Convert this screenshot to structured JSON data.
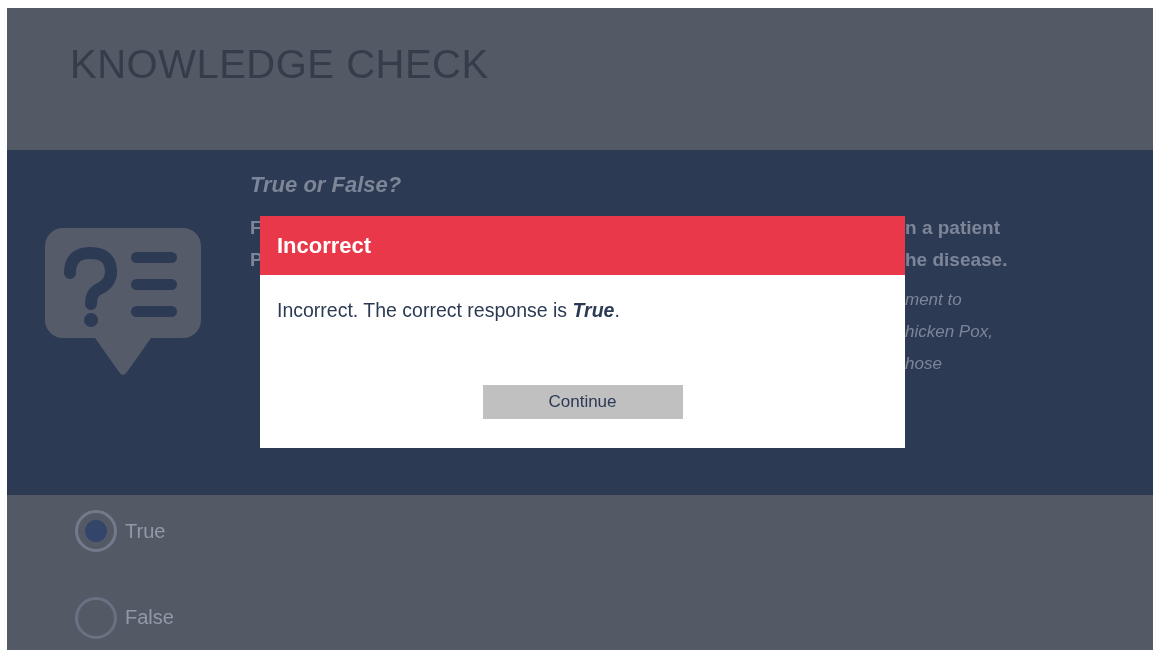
{
  "header": {
    "title": "KNOWLEDGE CHECK"
  },
  "question": {
    "heading": "True or False?",
    "fragments_left": [
      "F",
      "P"
    ],
    "fragments_right": [
      {
        "text": "n a patient",
        "kind": "bold"
      },
      {
        "text": "he disease.",
        "kind": "bold"
      },
      {
        "text": "ment to",
        "kind": "italic"
      },
      {
        "text": "hicken Pox,",
        "kind": "italic"
      },
      {
        "text": "hose",
        "kind": "italic"
      }
    ]
  },
  "options": [
    {
      "label": "True",
      "selected": true
    },
    {
      "label": "False",
      "selected": false
    }
  ],
  "dialog": {
    "title": "Incorrect",
    "message": "Incorrect. The correct response is **True**.",
    "button": "Continue"
  }
}
